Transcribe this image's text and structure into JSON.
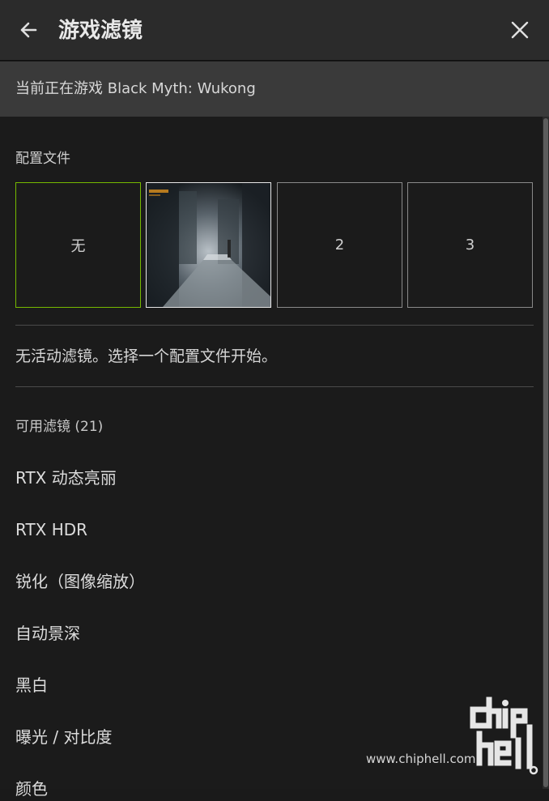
{
  "header": {
    "title": "游戏滤镜",
    "back_icon": "arrow-left-icon",
    "close_icon": "close-icon"
  },
  "game_bar": {
    "text": "当前正在游戏 Black Myth: Wukong"
  },
  "profiles": {
    "label": "配置文件",
    "items": [
      {
        "label": "无",
        "selected": true
      },
      {
        "label": "",
        "type": "thumbnail"
      },
      {
        "label": "2"
      },
      {
        "label": "3"
      }
    ]
  },
  "status_text": "无活动滤镜。选择一个配置文件开始。",
  "filters": {
    "header": "可用滤镜 (21)",
    "items": [
      "RTX 动态亮丽",
      "RTX HDR",
      "锐化（图像缩放）",
      "自动景深",
      "黑白",
      "曝光 / 对比度",
      "颜色"
    ]
  },
  "watermark": {
    "url": "www.chiphell.com",
    "logo_text": "chiphell"
  },
  "colors": {
    "accent": "#76b900",
    "header_bg": "#2b2b2b",
    "game_bar_bg": "#3a3a3a",
    "content_bg": "#1b1b1b"
  }
}
